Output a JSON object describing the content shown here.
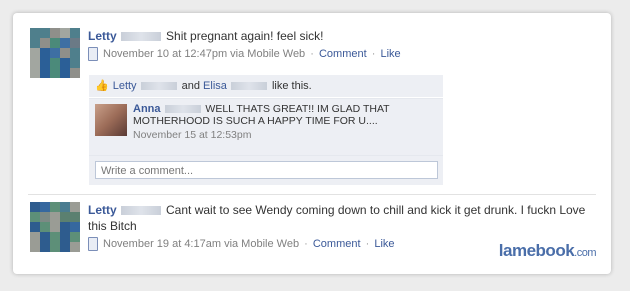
{
  "story1": {
    "author": "Letty",
    "status": "Shit pregnant again! feel sick!",
    "meta": {
      "time": "November 10 at 12:47pm via Mobile Web",
      "comment": "Comment",
      "like": "Like",
      "dot": "·"
    },
    "likes": {
      "person1": "Letty",
      "and": "and",
      "person2": "Elisa",
      "suffix": "like this."
    },
    "comment": {
      "author": "Anna",
      "text": "WELL THATS GREAT!! IM GLAD THAT MOTHERHOOD IS SUCH A HAPPY TIME FOR U....",
      "time": "November 15 at 12:53pm"
    },
    "write_placeholder": "Write a comment..."
  },
  "story2": {
    "author": "Letty",
    "status": "Cant wait to see Wendy coming down to chill and kick it get drunk. I fuckn Love this Bitch",
    "meta": {
      "time": "November 19 at 4:17am via Mobile Web",
      "comment": "Comment",
      "like": "Like",
      "dot": "·"
    }
  },
  "watermark": {
    "brand": "lamebook",
    "tld": ".com"
  }
}
